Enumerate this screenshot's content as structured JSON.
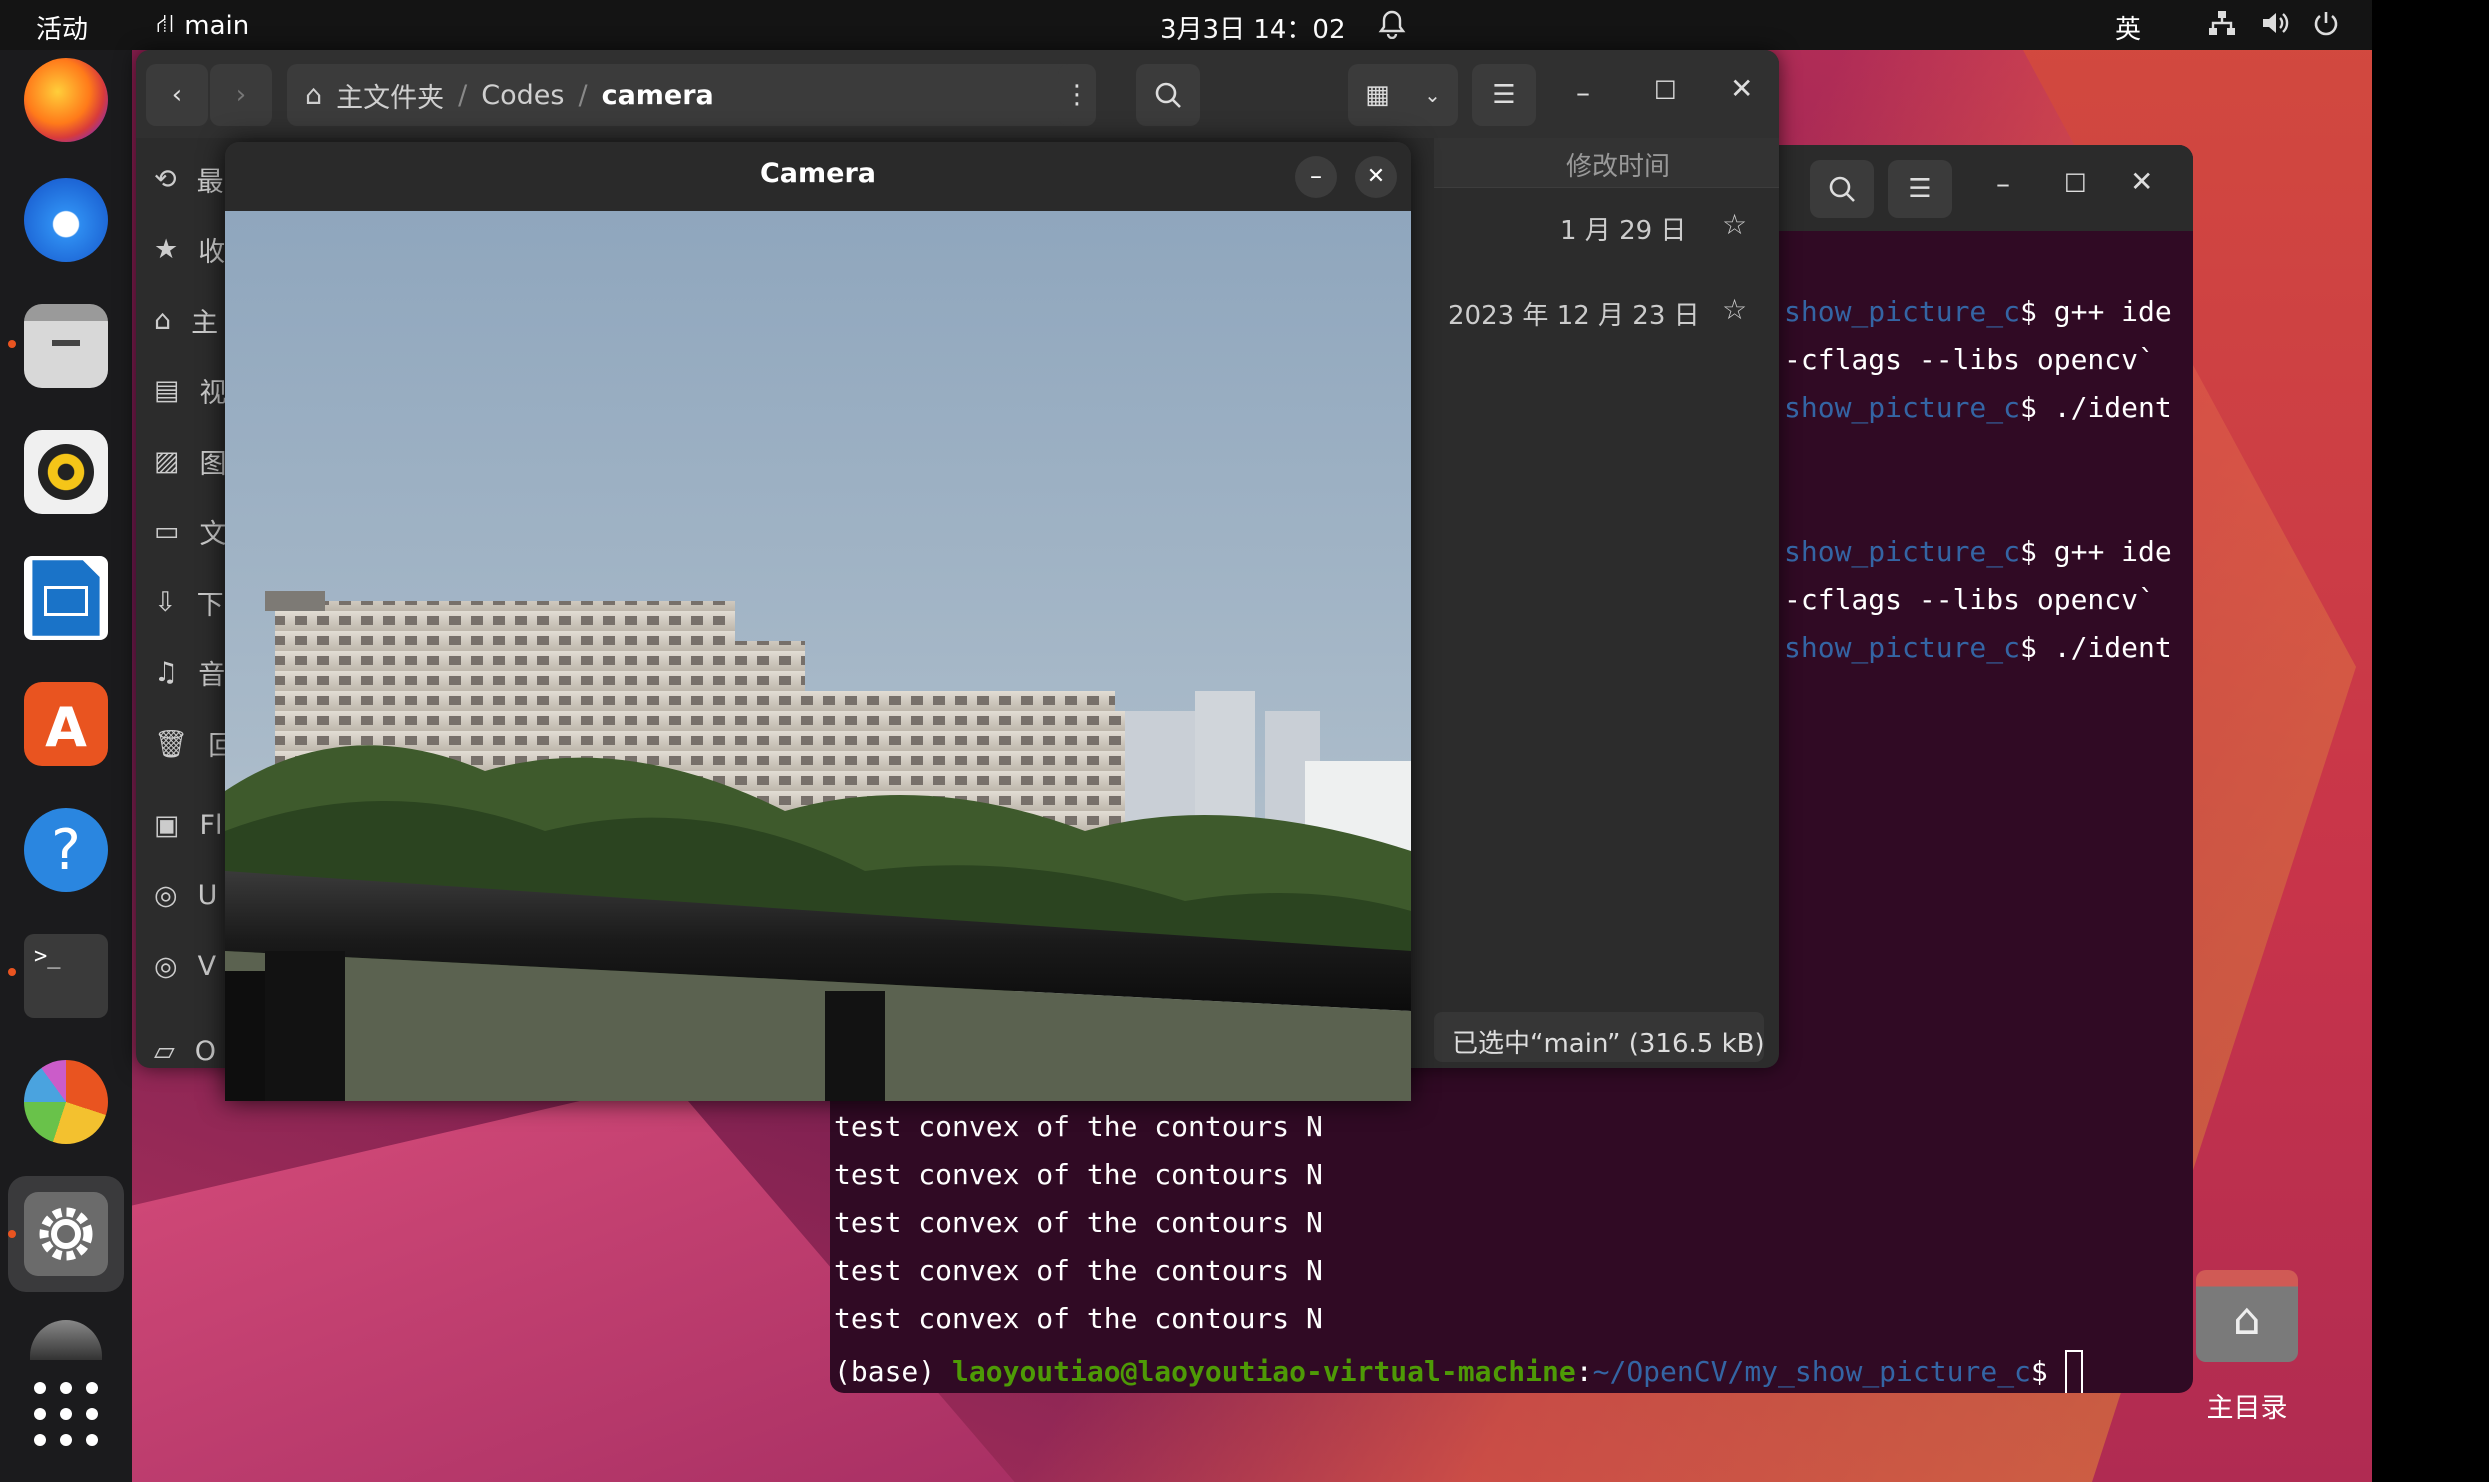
{
  "topbar": {
    "activities": "活动",
    "app_name": "main",
    "clock": "3月3日 14：02",
    "input_method": "英"
  },
  "files": {
    "breadcrumb": [
      "主文件夹",
      "/",
      "Codes",
      "/",
      "camera"
    ],
    "column_header": "修改时间",
    "rows": [
      {
        "date": "1 月 29 日"
      },
      {
        "date": "2023 年 12 月 23 日"
      }
    ],
    "sidebar": [
      "最",
      "收",
      "主",
      "视",
      "图",
      "文",
      "下",
      "音",
      "回",
      "Fl",
      "U",
      "V",
      "O"
    ],
    "status": "已选中“main” (316.5 kB)"
  },
  "camera": {
    "title": "Camera"
  },
  "terminal": {
    "lines_top": [
      {
        "prompt": "show_picture_c",
        "cmd": "$ g++ ide"
      },
      {
        "prompt": "",
        "cmd": "-cflags --libs opencv`"
      },
      {
        "prompt": "show_picture_c",
        "cmd": "$ ./ident"
      },
      {
        "prompt": "",
        "cmd": ""
      },
      {
        "prompt": "",
        "cmd": ""
      },
      {
        "prompt": "show_picture_c",
        "cmd": "$ g++ ide"
      },
      {
        "prompt": "",
        "cmd": "-cflags --libs opencv`"
      },
      {
        "prompt": "show_picture_c",
        "cmd": "$ ./ident"
      }
    ],
    "lines_bottom": [
      "test convex of the contours N",
      "test convex of the contours N",
      "test convex of the contours N",
      "test convex of the contours N",
      "test convex of the contours N"
    ],
    "final": {
      "base": "(base) ",
      "user": "laoyoutiao@laoyoutiao-virtual-machine",
      "colon": ":",
      "path": "~/OpenCV/my_show_picture_c",
      "dollar": "$ "
    }
  },
  "desktop_icon": {
    "label": "主目录"
  },
  "colors": {
    "topbar": "#141414",
    "dock": "#1b1b1d",
    "terminal_bg": "#300a24",
    "accent": "#e95420"
  }
}
